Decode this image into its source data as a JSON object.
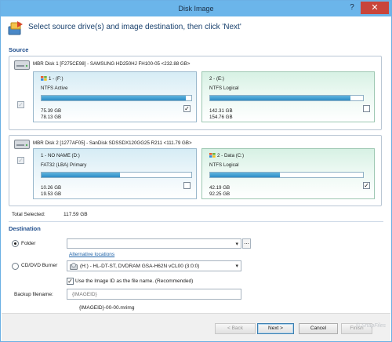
{
  "window": {
    "title": "Disk Image",
    "help_glyph": "?",
    "close_glyph": "✕"
  },
  "header": {
    "instruction": "Select source drive(s) and image destination, then click 'Next'"
  },
  "source": {
    "label": "Source",
    "disks": [
      {
        "title": "MBR Disk 1 [F275CE98] - SAMSUNG HD250HJ FH100-05  <232.88 GB>",
        "partitions": [
          {
            "name": "1 - (F:)",
            "type": "NTFS Active",
            "used": "75.39 GB",
            "total": "78.13 GB",
            "fill_fraction": 0.965,
            "checked": true,
            "color": "blue"
          },
          {
            "name": "2 - (E:)",
            "type": "NTFS Logical",
            "used": "142.31 GB",
            "total": "154.76 GB",
            "fill_fraction": 0.92,
            "checked": false,
            "color": "green"
          }
        ]
      },
      {
        "title": "MBR Disk 2 [1277AF05] - SanDisk SDSSDX120GG25 R211  <111.79 GB>",
        "partitions": [
          {
            "name": "1 - NO NAME (D:)",
            "type": "FAT32 (LBA) Primary",
            "used": "10.26 GB",
            "total": "19.53 GB",
            "fill_fraction": 0.525,
            "checked": false,
            "color": "blue"
          },
          {
            "name": "2 - Data (C:)",
            "type": "NTFS Logical",
            "used": "42.19 GB",
            "total": "92.25 GB",
            "fill_fraction": 0.457,
            "checked": true,
            "color": "green"
          }
        ]
      }
    ],
    "total_label": "Total Selected:",
    "total_value": "117.59 GB"
  },
  "destination": {
    "label": "Destination",
    "folder_label": "Folder",
    "folder_value": "",
    "ellipsis_label": "...",
    "alt_locations_link": "Alternative locations",
    "cd_label": "CD/DVD Burner",
    "burner_value": "(H:) - HL-DT-ST, DVDRAM GSA-H62N  vCL00 (3:0:0)",
    "use_id_label": "Use the Image ID as the file name.  (Recommended)",
    "use_id_checked": true,
    "backup_label": "Backup filename:",
    "backup_placeholder": "{IMAGEID}",
    "filename_preview": "{IMAGEID}-00-00.mrimg"
  },
  "footer": {
    "back_label": "< Back",
    "next_label": "Next >",
    "cancel_label": "Cancel",
    "finish_label": "Finish",
    "watermark": "© SnapFiles"
  },
  "colors": {
    "title_bar": "#6bb5ea",
    "close_button": "#c9453b",
    "partition_blue": "#d6ecf5",
    "partition_green": "#d7f1e4",
    "usage_bar": "#2e8cc6",
    "section_heading": "#1e4d8c",
    "link": "#1f63a8"
  },
  "icons": [
    "clone-disk-icon",
    "hard-drive-icon",
    "windows-logo-icon",
    "partition-drive-icon",
    "optical-drive-icon",
    "help-icon",
    "close-icon"
  ]
}
